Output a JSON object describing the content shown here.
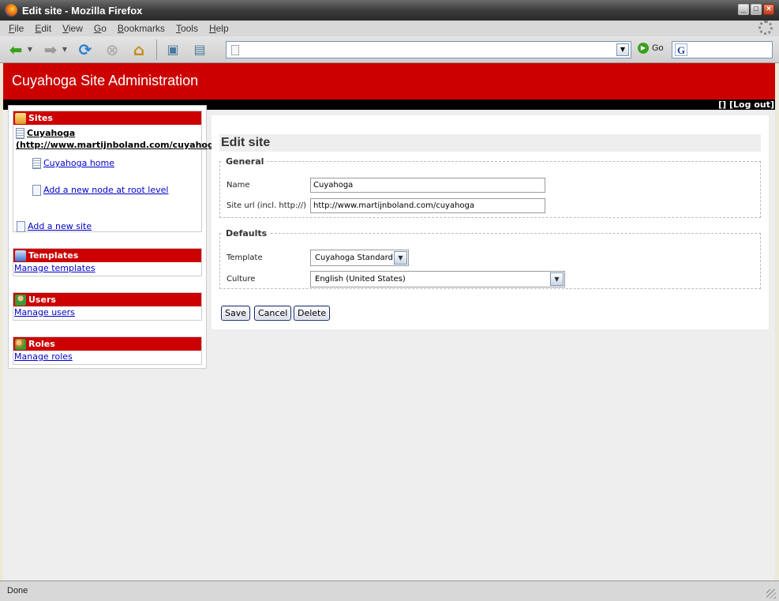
{
  "window": {
    "title": "Edit site - Mozilla Firefox",
    "minimize": "_",
    "maximize": "□",
    "close": "×"
  },
  "menu": {
    "items": [
      {
        "u": "F",
        "rest": "ile"
      },
      {
        "u": "E",
        "rest": "dit"
      },
      {
        "u": "V",
        "rest": "iew"
      },
      {
        "u": "G",
        "rest": "o"
      },
      {
        "u": "B",
        "rest": "ookmarks"
      },
      {
        "u": "T",
        "rest": "ools"
      },
      {
        "u": "H",
        "rest": "elp"
      }
    ]
  },
  "toolbar": {
    "back_icon": "arrow-left-icon",
    "forward_icon": "arrow-right-icon",
    "reload_icon": "reload-icon",
    "stop_icon": "stop-icon",
    "home_icon": "home-icon",
    "url_value": "",
    "go_label": "Go",
    "search_engine": "G"
  },
  "site": {
    "header_title": "Cuyahoga Site Administration",
    "user_links": "[] [Log out]"
  },
  "sidebar": {
    "sites": {
      "title": "Sites",
      "site_name": "Cuyahoga",
      "site_url": "(http://www.martijnboland.com/cuyahoga)",
      "home_node": "Cuyahoga home",
      "add_node": "Add a new node at root level",
      "add_site": "Add a new site"
    },
    "templates": {
      "title": "Templates",
      "link": "Manage templates"
    },
    "users": {
      "title": "Users",
      "link": "Manage users"
    },
    "roles": {
      "title": "Roles",
      "link": "Manage roles"
    }
  },
  "form": {
    "title": "Edit site",
    "general_legend": "General",
    "name_label": "Name",
    "name_value": "Cuyahoga",
    "url_label": "Site url (incl. http://)",
    "url_value": "http://www.martijnboland.com/cuyahoga",
    "defaults_legend": "Defaults",
    "template_label": "Template",
    "template_value": "Cuyahoga Standard",
    "culture_label": "Culture",
    "culture_value": "English (United States)",
    "save_label": "Save",
    "cancel_label": "Cancel",
    "delete_label": "Delete"
  },
  "status": {
    "text": "Done"
  },
  "colors": {
    "brand_red": "#cc0000",
    "link_blue": "#0000cc"
  }
}
